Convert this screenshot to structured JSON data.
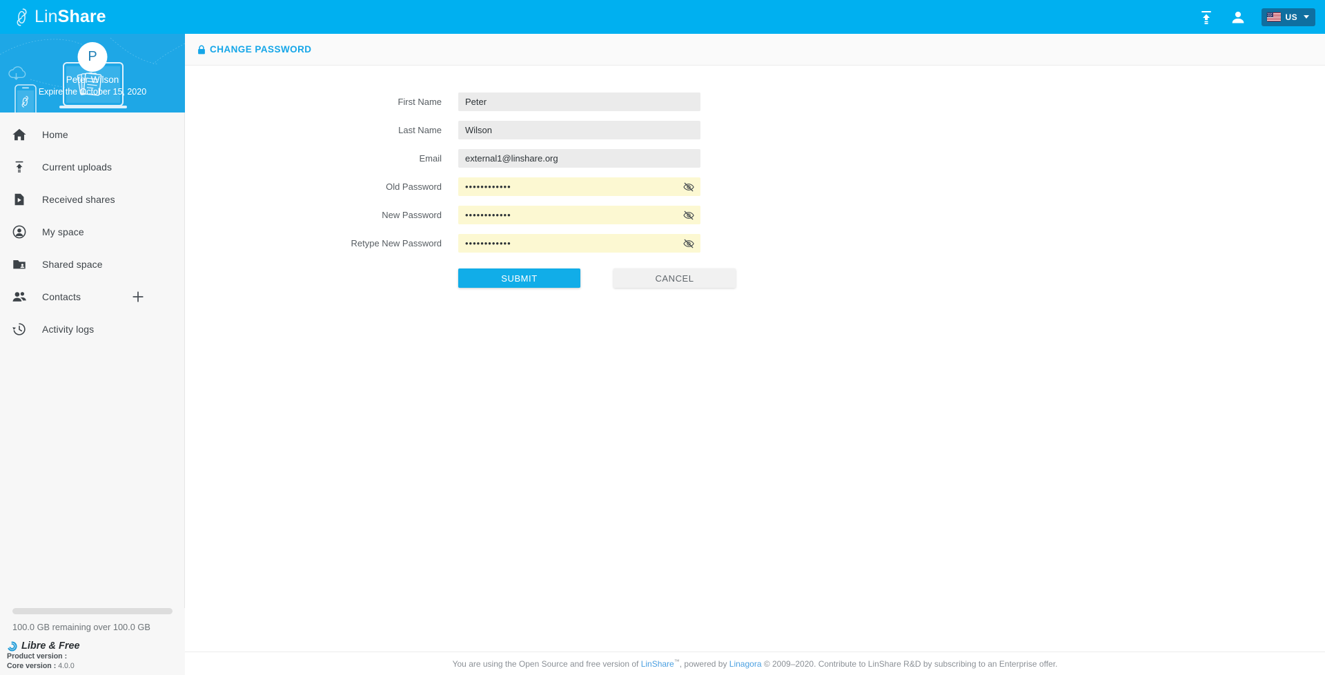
{
  "topbar": {
    "brand_lin": "Lin",
    "brand_share": "Share",
    "brand_icon": "link-logo-icon",
    "upload_icon": "upload-icon",
    "account_icon": "account-icon",
    "language": {
      "label": "US",
      "flag_icon": "us-flag-icon",
      "caret_icon": "chevron-down-icon"
    },
    "accent_color": "#00b0f0"
  },
  "sidebar": {
    "profile": {
      "avatar_initial": "P",
      "name": "Peter Wilson",
      "expire": "Expire the October 15, 2020",
      "banner_color": "#1ea7e6"
    },
    "items": [
      {
        "label": "Home",
        "icon": "home-icon"
      },
      {
        "label": "Current uploads",
        "icon": "upload-icon"
      },
      {
        "label": "Received shares",
        "icon": "received-shares-icon"
      },
      {
        "label": "My space",
        "icon": "person-circle-icon"
      },
      {
        "label": "Shared space",
        "icon": "folder-shared-icon"
      },
      {
        "label": "Contacts",
        "icon": "contacts-icon",
        "action_icon": "plus-icon"
      },
      {
        "label": "Activity logs",
        "icon": "history-icon"
      }
    ],
    "footer": {
      "quota_text": "100.0 GB remaining over 100.0 GB",
      "quota_percent": 0,
      "libre_label": "Libre & Free",
      "libre_icon": "libre-free-icon",
      "product_version_label": "Product version :",
      "product_version_value": "",
      "core_version_label": "Core version :",
      "core_version_value": "4.0.0"
    }
  },
  "page": {
    "title": "CHANGE PASSWORD",
    "title_icon": "lock-icon",
    "title_color": "#15a6e8"
  },
  "form": {
    "fields": [
      {
        "label": "First Name",
        "value": "Peter",
        "type": "text",
        "placeholder": ""
      },
      {
        "label": "Last Name",
        "value": "Wilson",
        "type": "text",
        "placeholder": ""
      },
      {
        "label": "Email",
        "value": "external1@linshare.org",
        "type": "text",
        "placeholder": ""
      },
      {
        "label": "Old Password",
        "value": "••••••••••••",
        "type": "password",
        "placeholder": "",
        "toggle_icon": "visibility-off-icon"
      },
      {
        "label": "New Password",
        "value": "••••••••••••",
        "type": "password",
        "placeholder": "",
        "toggle_icon": "visibility-off-icon"
      },
      {
        "label": "Retype New Password",
        "value": "••••••••••••",
        "type": "password",
        "placeholder": "",
        "toggle_icon": "visibility-off-icon"
      }
    ],
    "submit_label": "SUBMIT",
    "cancel_label": "CANCEL"
  },
  "footer": {
    "part1": "You are using the Open Source and free version of ",
    "link1": "LinShare",
    "trademark": "™",
    "part2": ", powered by ",
    "link2": "Linagora",
    "part3": " © 2009–2020. Contribute to LinShare R&D by subscribing to an Enterprise offer."
  }
}
